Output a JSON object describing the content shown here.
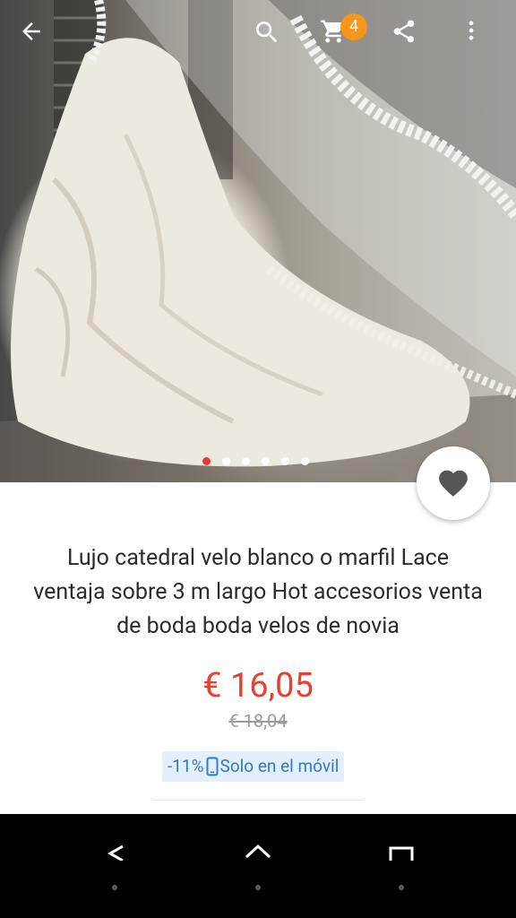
{
  "product": {
    "title": "Lujo catedral velo blanco o marfil Lace ventaja sobre 3 m largo Hot accesorios venta de boda boda velos de novia",
    "price": "€ 16,05",
    "original_price": "€ 18,04",
    "discount": "-11%",
    "promo_label": "Solo en el móvil",
    "image_description_icon": "product-photo",
    "gallery_count": 6,
    "gallery_active_index": 0
  },
  "toolbar": {
    "cart_count": "4",
    "icons": [
      "back-arrow-icon",
      "search-icon",
      "cart-icon",
      "share-icon",
      "more-vertical-icon"
    ]
  },
  "colors": {
    "price": "#e8402f",
    "badge": "#f7961a",
    "promo_bg": "#e3f0fb",
    "promo_text": "#2e7bc4",
    "dot_active": "#e53935"
  },
  "system_nav": {
    "icons": [
      "nav-back-icon",
      "nav-home-icon",
      "nav-recents-icon"
    ]
  }
}
